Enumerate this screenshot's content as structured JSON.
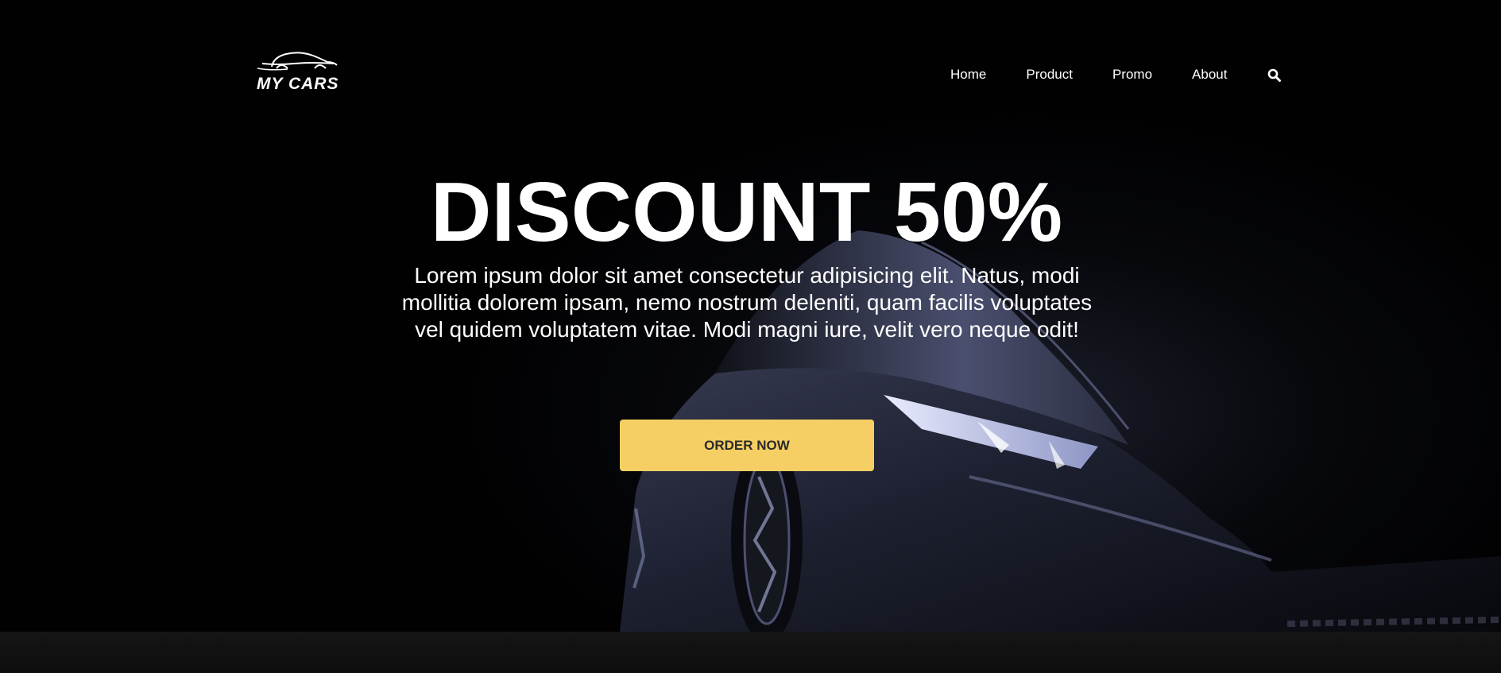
{
  "colors": {
    "background": "#020203",
    "accent_button": "#f5cf63",
    "text": "#ffffff",
    "footer_band": "#131313"
  },
  "logo": {
    "text": "MY CARS",
    "icon": "car-outline-icon"
  },
  "nav": {
    "items": [
      {
        "label": "Home"
      },
      {
        "label": "Product"
      },
      {
        "label": "Promo"
      },
      {
        "label": "About"
      }
    ],
    "search_icon": "search-icon"
  },
  "hero": {
    "title": "DISCOUNT 50%",
    "text": "Lorem ipsum dolor sit amet consectetur adipisicing elit. Natus, modi mollitia dolorem ipsam, nemo nostrum deleniti, quam facilis voluptates vel quidem voluptatem vitae. Modi magni iure, velit vero neque odit!",
    "button_label": "ORDER NOW",
    "background_image": "dark-sports-car-image"
  }
}
